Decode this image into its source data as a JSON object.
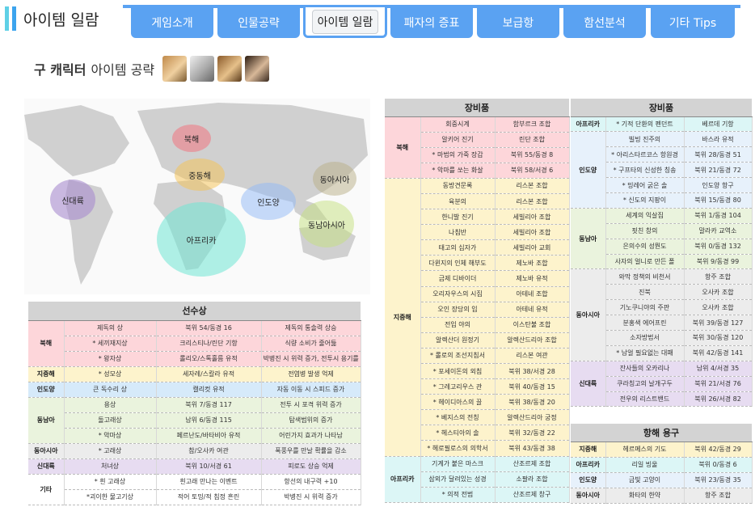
{
  "header": {
    "title": "아이템 일람",
    "tabs": [
      "게임소개",
      "인물공략",
      "아이템 일람",
      "패자의 증표",
      "보급항",
      "함선분석",
      "기타 Tips"
    ],
    "active_tab": 2
  },
  "section": {
    "bold": "구 캐릭터",
    "rest": "아이템 공략"
  },
  "map": {
    "regions": [
      {
        "label": "북해",
        "color": "#f1747f"
      },
      {
        "label": "중동해",
        "color": "#f5c24f"
      },
      {
        "label": "동아시아",
        "color": "#b7ad86"
      },
      {
        "label": "신대륙",
        "color": "#a98ccf"
      },
      {
        "label": "인도양",
        "color": "#8fb8f5"
      },
      {
        "label": "동남아시아",
        "color": "#c4e07d"
      },
      {
        "label": "아프리카",
        "color": "#70e6d3"
      }
    ]
  },
  "tables": {
    "treasures": {
      "title": "선수상",
      "groups": [
        {
          "cat": "북해",
          "cls": "pk",
          "rows": [
            [
              "제독의 상",
              "북위 54/동경 16",
              "제독의 통솔력 상승"
            ],
            [
              "* 세끼재지상",
              "크리스티나/린단 기항",
              "식량 소비가 줄어듦"
            ],
            [
              "* 왕자상",
              "롤리오/스톡홀름 유적",
              "박병진 시 위력 증가, 전투시 용기를 줌"
            ]
          ]
        },
        {
          "cat": "지중해",
          "cls": "yl",
          "rows": [
            [
              "* 성모상",
              "세자레/스칼라 유적",
              "전염병 발생 억제"
            ]
          ]
        },
        {
          "cat": "인도양",
          "cls": "bl",
          "rows": [
            [
              "큰 독수리 상",
              "캘리컷 유적",
              "자동 이동 시 스피드 증가"
            ]
          ]
        },
        {
          "cat": "동남아",
          "cls": "gr",
          "rows": [
            [
              "용상",
              "북위 7/동경 117",
              "전투 시 포격 위력 증가"
            ],
            [
              "돌고래상",
              "남위 6/동경 115",
              "탐색범위의 증가"
            ],
            [
              "* 악마상",
              "페르난도/바타비아 유적",
              "어린가지 효과가 나타남"
            ]
          ]
        },
        {
          "cat": "동아시아",
          "cls": "gy",
          "rows": [
            [
              "* 고래상",
              "참/오사카 여관",
              "폭풍우를 만날 확률을 감소"
            ]
          ]
        },
        {
          "cat": "신대륙",
          "cls": "pu",
          "rows": [
            [
              "처녀상",
              "북위 10/서경 61",
              "피로도 상승 억제"
            ]
          ]
        },
        {
          "cat": "기타",
          "cls": "wt",
          "rows": [
            [
              "* 흰 고래상",
              "흰고래 만나는 이벤트",
              "항선의 내구력 +10"
            ],
            [
              "*괴이한 물고기상",
              "적어 토밍/적 침정 흔린",
              "박병진 시 위력 증가"
            ]
          ]
        }
      ]
    },
    "equip1": {
      "title": "장비품",
      "groups": [
        {
          "cat": "북해",
          "cls": "pk",
          "rows": [
            [
              "회중시계",
              "함부르크 조합"
            ],
            [
              "알키어 진기",
              "린단 조합"
            ],
            [
              "* 마법의 가죽 장갑",
              "북위 55/동경 8"
            ],
            [
              "* 악마를 쏘는 화살",
              "북위 58/서경 6"
            ]
          ]
        },
        {
          "cat": "지중해",
          "cls": "yl",
          "rows": [
            [
              "동방견문록",
              "리스본 조합"
            ],
            [
              "육분의",
              "리스본 조합"
            ],
            [
              "한니발 진기",
              "세빌리아 조합"
            ],
            [
              "나침반",
              "세빌리아 조합"
            ],
            [
              "태고의 십자가",
              "세빌리아 교회"
            ],
            [
              "다윈지의 인체 해부도",
              "제노바 조합"
            ],
            [
              "금제 디바이더",
              "제노바 유적"
            ],
            [
              "오리자우스의 시집",
              "아테네 조합"
            ],
            [
              "오인 장당의 입",
              "아테네 유적"
            ],
            [
              "전입 야의",
              "이스탄불 조합"
            ],
            [
              "알렉산더 원정기",
              "알렉산드리아 조합"
            ],
            [
              "* 롤로의 조선지침서",
              "리스본 여관"
            ],
            [
              "* 포세이돈의 외침",
              "북위 38/서경 28"
            ],
            [
              "* 그레고리우스 관",
              "북위 40/동경 15"
            ],
            [
              "* 헤이디아스의 끌",
              "북위 38/동경 20"
            ],
            [
              "* 베지스의 전칭",
              "알렉산드리아 궁정"
            ],
            [
              "* 헤스티아의 솔",
              "북위 32/동경 22"
            ],
            [
              "* 헤로필로스의 의학서",
              "북위 43/동경 38"
            ]
          ]
        },
        {
          "cat": "아프리카",
          "cls": "cy",
          "rows": [
            [
              "기계가 붙은 마스크",
              "산조르제 조합"
            ],
            [
              "삼외가 달려있는 성경",
              "소팔라 조합"
            ],
            [
              "* 의적 전범",
              "산조르제 창구"
            ]
          ]
        }
      ]
    },
    "equip2": {
      "title": "장비품",
      "groups": [
        {
          "cat": "아프리카",
          "cls": "cy",
          "rows": [
            [
              "* 기적 단환의 펜던트",
              "베르데 기항"
            ]
          ]
        },
        {
          "cat": "인도양",
          "cls": "pw",
          "rows": [
            [
              "빌빙 진주의",
              "바스라 유적"
            ],
            [
              "* 아리스타르코스 항원경",
              "북위 28/동경 51"
            ],
            [
              "* 구프타의 신성한 칭송",
              "북위 21/동경 72"
            ],
            [
              "* 밍레어 굵은 솔",
              "인도양 항구"
            ],
            [
              "* 신도의 지팡이",
              "북위 15/동경 80"
            ]
          ]
        },
        {
          "cat": "동남아",
          "cls": "gr",
          "rows": [
            [
              "세계의 익살집",
              "북위 1/동경 104"
            ],
            [
              "핏친 창의",
              "말라카 교역소"
            ],
            [
              "은의수의 성뭔도",
              "북위 0/동경 132"
            ],
            [
              "사자의 얼니로 만든 폴",
              "북위 9/동경 99"
            ]
          ]
        },
        {
          "cat": "동아시아",
          "cls": "gy",
          "rows": [
            [
              "와막 정책의 비천서",
              "항주 조합"
            ],
            [
              "진북",
              "오사카 조합"
            ],
            [
              "기노쿠니야의 주판",
              "오사카 조합"
            ],
            [
              "분홍색 에어프린",
              "북위 39/동경 127"
            ],
            [
              "소자방법서",
              "북위 30/동경 120"
            ],
            [
              "* 남얼 필요없는 대패",
              "북위 42/동경 141"
            ]
          ]
        },
        {
          "cat": "신대륙",
          "cls": "pu",
          "rows": [
            [
              "잔사들의 오카리나",
              "남위 4/서경 35"
            ],
            [
              "쿠라칭고의 날개구두",
              "북위 21/서경 76"
            ],
            [
              "전우의 리스트밴드",
              "북위 26/서경 82"
            ]
          ]
        }
      ]
    },
    "voyage": {
      "title": "항해 용구",
      "groups": [
        {
          "cat": "지중해",
          "cls": "yl",
          "rows": [
            [
              "헤르메스의 기도",
              "북위 42/동경 29"
            ]
          ]
        },
        {
          "cat": "아프리카",
          "cls": "cy",
          "rows": [
            [
              "리일 빙울",
              "북위 0/동경 6"
            ]
          ]
        },
        {
          "cat": "인도양",
          "cls": "pw",
          "rows": [
            [
              "금빛 고양이",
              "북위 23/동경 35"
            ]
          ]
        },
        {
          "cat": "동아시아",
          "cls": "gy",
          "rows": [
            [
              "화타의 한약",
              "항주 조합"
            ]
          ]
        }
      ]
    }
  }
}
